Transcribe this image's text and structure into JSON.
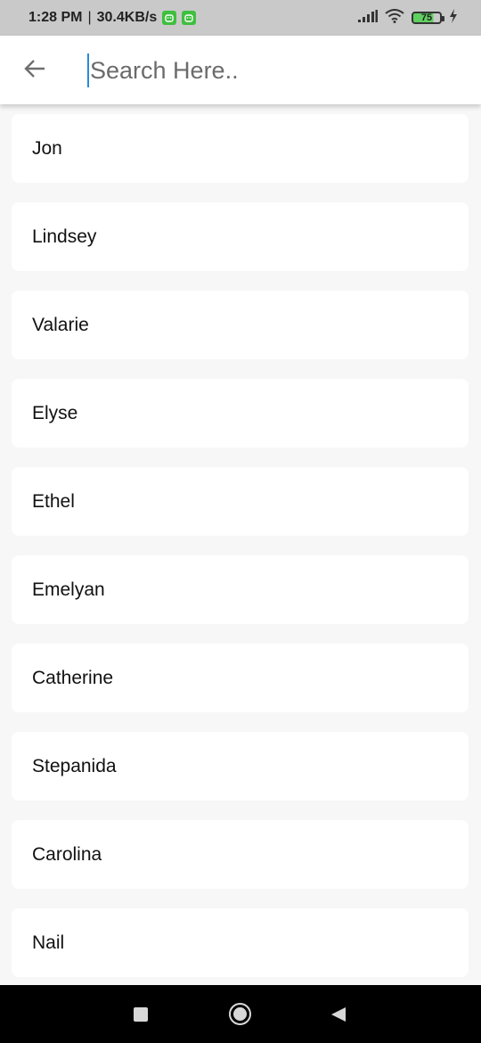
{
  "status_bar": {
    "time": "1:28 PM",
    "separator": "|",
    "speed": "30.4KB/s",
    "battery_level": "75",
    "icons": [
      "android-notification-icon",
      "android-notification-icon",
      "signal-icon",
      "wifi-icon",
      "battery-icon",
      "charging-icon"
    ]
  },
  "app_bar": {
    "back_icon": "arrow-left-icon",
    "search_placeholder": "Search Here..",
    "search_value": ""
  },
  "list": {
    "items": [
      {
        "label": "Jon"
      },
      {
        "label": "Lindsey"
      },
      {
        "label": "Valarie"
      },
      {
        "label": "Elyse"
      },
      {
        "label": "Ethel"
      },
      {
        "label": "Emelyan"
      },
      {
        "label": "Catherine"
      },
      {
        "label": "Stepanida"
      },
      {
        "label": "Carolina"
      },
      {
        "label": "Nail"
      }
    ]
  },
  "nav_bar": {
    "icons": [
      "recents-square-icon",
      "home-circle-icon",
      "back-triangle-icon"
    ]
  },
  "colors": {
    "status_bar_bg": "#c9c9c9",
    "background": "#f7f7f7",
    "card": "#ffffff",
    "cursor": "#2a8bd6",
    "nav_bar": "#000000"
  }
}
